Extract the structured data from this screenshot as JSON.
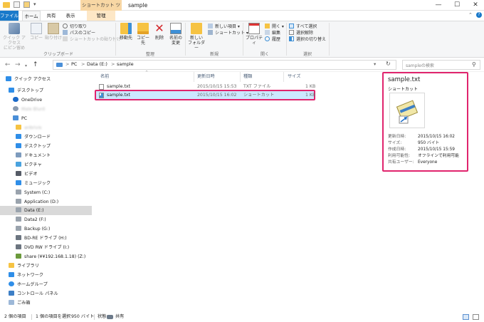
{
  "window": {
    "title": "sample",
    "context_tab": "ショートカット ツール"
  },
  "tabs": {
    "file": "ファイル",
    "home": "ホーム",
    "share": "共有",
    "view": "表示",
    "manage": "管理"
  },
  "ribbon": {
    "clipboard": {
      "pin": "クイック アクセス\nにピン留め",
      "copy": "コピー",
      "paste": "貼り付け",
      "cut": "切り取り",
      "copy_path": "パスのコピー",
      "paste_shortcut": "ショートカットの貼り付け",
      "label": "クリップボード"
    },
    "organize": {
      "move": "移動先",
      "copyto": "コピー先",
      "delete": "削除",
      "rename": "名前の\n変更",
      "label": "整理"
    },
    "new": {
      "folder": "新しい\nフォルダー",
      "item": "新しい項目 ▾",
      "shortcut": "ショートカット ▾",
      "label": "新規"
    },
    "open": {
      "props": "プロパティ",
      "open": "開く ▾",
      "edit": "編集",
      "history": "履歴",
      "label": "開く"
    },
    "select": {
      "all": "すべて選択",
      "none": "選択解除",
      "invert": "選択の切り替え",
      "label": "選択"
    }
  },
  "address": {
    "crumbs": [
      "PC",
      "Data (E:)",
      "sample"
    ],
    "sep": ">",
    "search_placeholder": "sampleの検索"
  },
  "nav": {
    "quick_access": "クイック アクセス",
    "desktop1": "デスクトップ",
    "onedrive": "OneDrive",
    "user": "Male Blurd",
    "pc": "PC",
    "pcuser": "anbrivis",
    "downloads": "ダウンロード",
    "desktop2": "デスクトップ",
    "documents": "ドキュメント",
    "pictures": "ピクチャ",
    "videos": "ビデオ",
    "music": "ミュージック",
    "system": "System (C:)",
    "application": "Application (D:)",
    "data": "Data (E:)",
    "data2": "Data2 (F:)",
    "backup": "Backup (G:)",
    "bdre": "BD-RE ドライブ (H:)",
    "dvd": "DVD RW ドライブ (I:)",
    "share": "share (¥¥192.168.1.18) (Z:)",
    "library": "ライブラリ",
    "network": "ネットワーク",
    "homegroup": "ホームグループ",
    "control": "コントロール パネル",
    "trash": "ごみ箱"
  },
  "columns": {
    "name": "名前",
    "date": "更新日時",
    "type": "種類",
    "size": "サイズ"
  },
  "files": [
    {
      "name": "sample.txt",
      "date": "2015/10/15 15:53",
      "type": "TXT ファイル",
      "size": "1 KB"
    },
    {
      "name": "sample.txt",
      "date": "2015/10/15 16:02",
      "type": "ショートカット",
      "size": "1 KB"
    }
  ],
  "preview": {
    "name": "sample.txt",
    "kind": "ショートカット",
    "rows": [
      {
        "k": "更新日時:",
        "v": "2015/10/15 16:02"
      },
      {
        "k": "サイズ:",
        "v": "950 バイト"
      },
      {
        "k": "作成日時:",
        "v": "2015/10/15 15:59"
      },
      {
        "k": "利用可能性:",
        "v": "オフラインで利用可能"
      },
      {
        "k": "共有ユーザー:",
        "v": "Everyone"
      }
    ]
  },
  "status": {
    "count": "2 個の項目",
    "selected": "1 個の項目を選択",
    "bytes": "950 バイト",
    "state_label": "状態:",
    "state_value": "共有"
  },
  "colors": {
    "accent": "#1979ca",
    "highlight": "#e0246d",
    "selected_row": "#cce8ff",
    "context_tab": "#f8d7a4"
  }
}
